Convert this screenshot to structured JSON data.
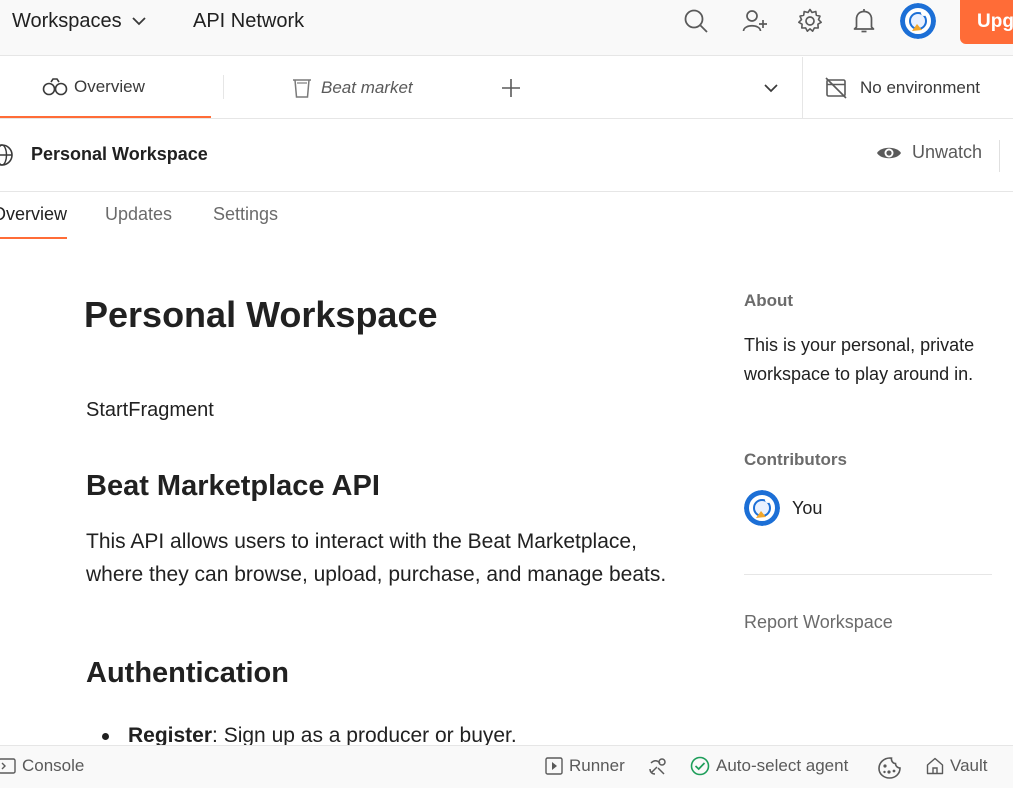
{
  "header": {
    "workspaces_label": "Workspaces",
    "api_network_label": "API Network",
    "upgrade_label": "Upgrade",
    "icons": [
      "search-icon",
      "invite-user-icon",
      "settings-icon",
      "notifications-icon",
      "avatar"
    ]
  },
  "tabs": {
    "overview_label": "Overview",
    "beat_label": "Beat market",
    "environment_label": "No environment"
  },
  "workspace": {
    "title": "Personal Workspace",
    "unwatch_label": "Unwatch"
  },
  "subtabs": {
    "overview": "Overview",
    "updates": "Updates",
    "settings": "Settings"
  },
  "content": {
    "title": "Personal Workspace",
    "start_fragment": "StartFragment",
    "api_heading": "Beat Marketplace API",
    "api_paragraph": "This API allows users to interact with the Beat Marketplace, where they can browse, upload, purchase, and manage beats.",
    "auth_heading": "Authentication",
    "bullet_bold": "Register",
    "bullet_text": ": Sign up as a producer or buyer."
  },
  "sidebar": {
    "about_heading": "About",
    "about_text": "This is your personal, private workspace to play around in.",
    "contributors_heading": "Contributors",
    "contributor_name": "You",
    "report_label": "Report Workspace"
  },
  "statusbar": {
    "console_label": "Console",
    "runner_label": "Runner",
    "agent_label": "Auto-select agent",
    "vault_label": "Vault"
  },
  "colors": {
    "accent": "#ff6c37",
    "avatar_blue": "#1c6fd6",
    "agent_green": "#1e9e5a"
  }
}
